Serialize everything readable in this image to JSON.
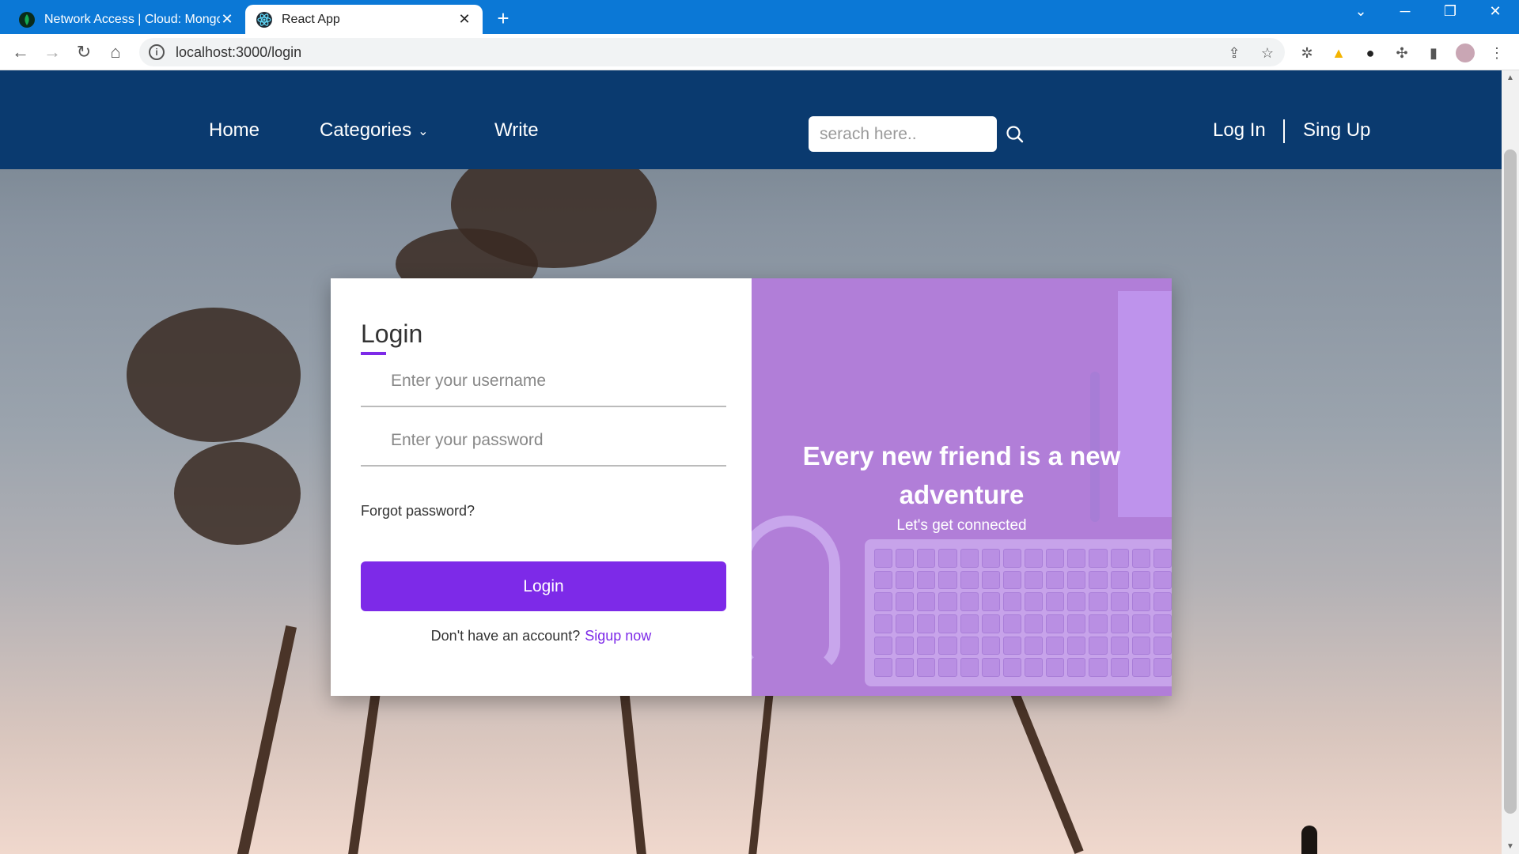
{
  "browser": {
    "tabs": [
      {
        "title": "Network Access | Cloud: MongoDB",
        "icon": "mongodb-leaf-icon",
        "active": false
      },
      {
        "title": "React App",
        "icon": "react-icon",
        "active": true
      }
    ],
    "new_tab": "+",
    "url": "localhost:3000/login"
  },
  "nav": {
    "home": "Home",
    "categories": "Categories",
    "write": "Write",
    "search_placeholder": "serach here..",
    "login": "Log In",
    "signup": "Sing Up"
  },
  "login": {
    "title": "Login",
    "username_placeholder": "Enter your username",
    "password_placeholder": "Enter your password",
    "forgot": "Forgot password?",
    "button": "Login",
    "no_account": "Don't have an account?",
    "signup_link": "Sigup now"
  },
  "promo": {
    "headline": "Every new friend is a new adventure",
    "subline": "Let's get connected"
  },
  "colors": {
    "nav_bg": "#0a3a6f",
    "accent": "#7d2ae8",
    "promo_bg": "#b17ed8"
  }
}
